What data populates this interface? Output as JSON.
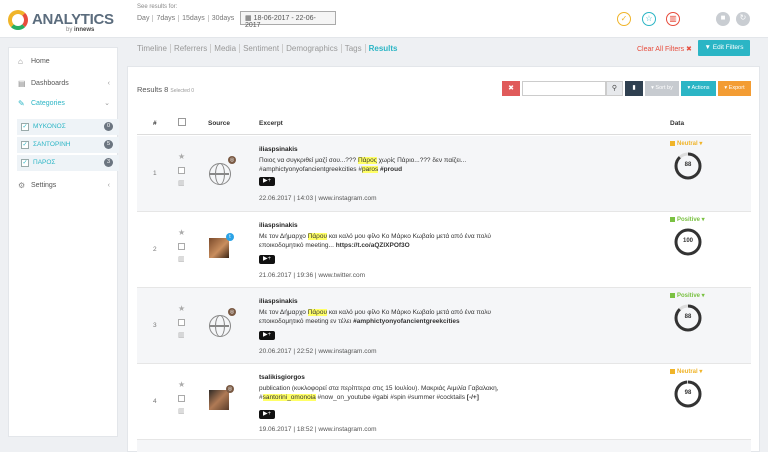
{
  "header": {
    "logo_text": "ANALYTICS",
    "logo_by": "by",
    "logo_brand": "innews",
    "see_results_label": "See results for:",
    "ranges": [
      "Day",
      "7days",
      "15days",
      "30days"
    ],
    "date_range": "18-06-2017 - 22-06-2017"
  },
  "sidebar": {
    "home": "Home",
    "dashboards": "Dashboards",
    "categories": "Categories",
    "settings": "Settings",
    "category_items": [
      {
        "label": "ΜΥΚΟΝΟΣ",
        "count": "0"
      },
      {
        "label": "ΣΑΝΤΟΡΙΝΗ",
        "count": "5"
      },
      {
        "label": "ΠΑΡΟΣ",
        "count": "3"
      }
    ]
  },
  "tabs": [
    "Timeline",
    "Referrers",
    "Media",
    "Sentiment",
    "Demographics",
    "Tags",
    "Results"
  ],
  "toolbar": {
    "clear_all": "Clear All Filters ✖",
    "edit_filters": "▼ Edit Filters",
    "results_label": "Results 8",
    "selected": "Selected 0",
    "sort_by": "▾ Sort by",
    "actions": "▾ Actions",
    "export": "▾ Export"
  },
  "table": {
    "col_num": "#",
    "col_source": "Source",
    "col_excerpt": "Excerpt",
    "col_data": "Data",
    "rows": [
      {
        "num": "1",
        "author": "iliaspsinakis",
        "excerpt_pre": "Ποιος να συγκριθεί μαζί σου...??? ",
        "hl1": "Πάρος",
        "excerpt_mid": " χωρίς Πάριο...??? δεν παίζει... #amphictyonyofancientgreekcities #",
        "hl2": "paros",
        "excerpt_post": " #proud",
        "meta": "22.06.2017 | 14:03 | www.instagram.com",
        "sentiment": "Neutral ▾",
        "score": "88"
      },
      {
        "num": "2",
        "author": "iliaspsinakis",
        "excerpt_pre": "Με τον Δήμαρχο ",
        "hl1": "Πάρου",
        "excerpt_mid": " και καλό μου φίλο Κο Μάρκο Κωβαίο μετά από ένα πολύ εποικοδομητικό meeting... ",
        "hl2": "",
        "excerpt_post": "https://t.co/aQZlXPOf3O",
        "meta": "21.06.2017 | 19:36 | www.twitter.com",
        "sentiment": "Positive ▾",
        "score": "100"
      },
      {
        "num": "3",
        "author": "iliaspsinakis",
        "excerpt_pre": "Με τον Δήμαρχο ",
        "hl1": "Πάρου",
        "excerpt_mid": " και καλό μου φίλο Κο Μάρκο Κωβαίο μετά από ένα πολυ εποικοδομητικό meeting εν τέλει ",
        "hl2": "",
        "excerpt_post": "#amphictyonyofancientgreekcities",
        "meta": "20.06.2017 | 22:52 | www.instagram.com",
        "sentiment": "Positive ▾",
        "score": "88"
      },
      {
        "num": "4",
        "author": "tsalikisgiorgos",
        "excerpt_pre": "publication (κυκλοφορεί στα περίπτερα στις 15 Ιουλίου). Μακριάς Αιμιλία Γαβαλακη, #",
        "hl1": "santorini_omonoia",
        "excerpt_mid": " #now_on_youtube #gabi #spin #summer #cocktails ",
        "hl2": "",
        "excerpt_post": "[-/+]",
        "meta": "19.06.2017 | 18:52 | www.instagram.com",
        "sentiment": "Neutral ▾",
        "score": "98"
      }
    ]
  },
  "colors": {
    "accent": "#2bb5c5",
    "danger": "#e74c3c",
    "warning": "#f39c33",
    "neutral": "#f0b429",
    "positive": "#7ac142"
  }
}
